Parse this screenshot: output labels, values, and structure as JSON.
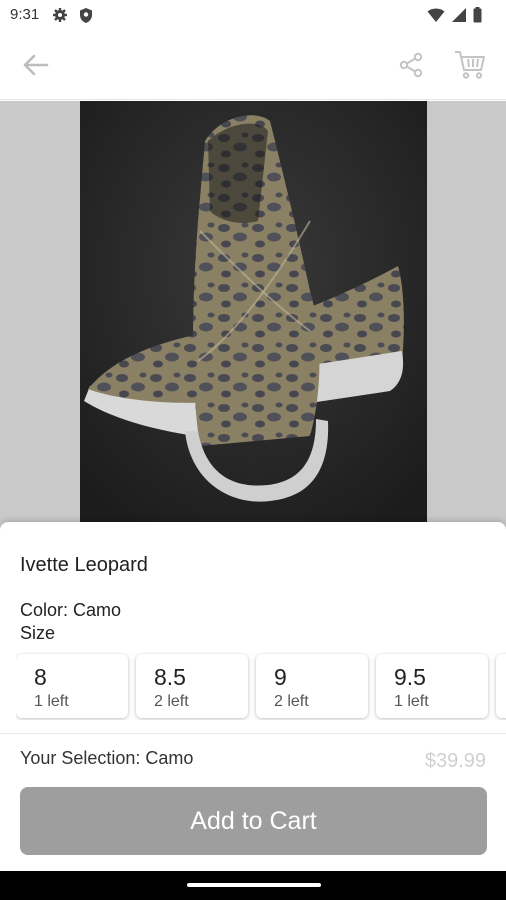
{
  "status_bar": {
    "time": "9:31",
    "icons": [
      "gear-icon",
      "shield-icon",
      "wifi-icon",
      "signal-icon",
      "battery-icon"
    ]
  },
  "toolbar": {
    "icons": [
      "back-arrow-icon",
      "share-icon",
      "cart-icon"
    ]
  },
  "product": {
    "image_alt": "leopard print slip-on sneaker",
    "name": "Ivette Leopard",
    "color_line": "Color: Camo",
    "size_label": "Size",
    "sizes": [
      {
        "size": "8",
        "stock": "1 left"
      },
      {
        "size": "8.5",
        "stock": "2 left"
      },
      {
        "size": "9",
        "stock": "2 left"
      },
      {
        "size": "9.5",
        "stock": "1 left"
      }
    ],
    "selection": "Your Selection: Camo",
    "price": "$39.99",
    "add_to_cart_label": "Add to Cart"
  },
  "colors": {
    "image_background": "#c9c9c9",
    "button_disabled": "#9e9e9e",
    "price_muted": "#d0d0d0"
  }
}
